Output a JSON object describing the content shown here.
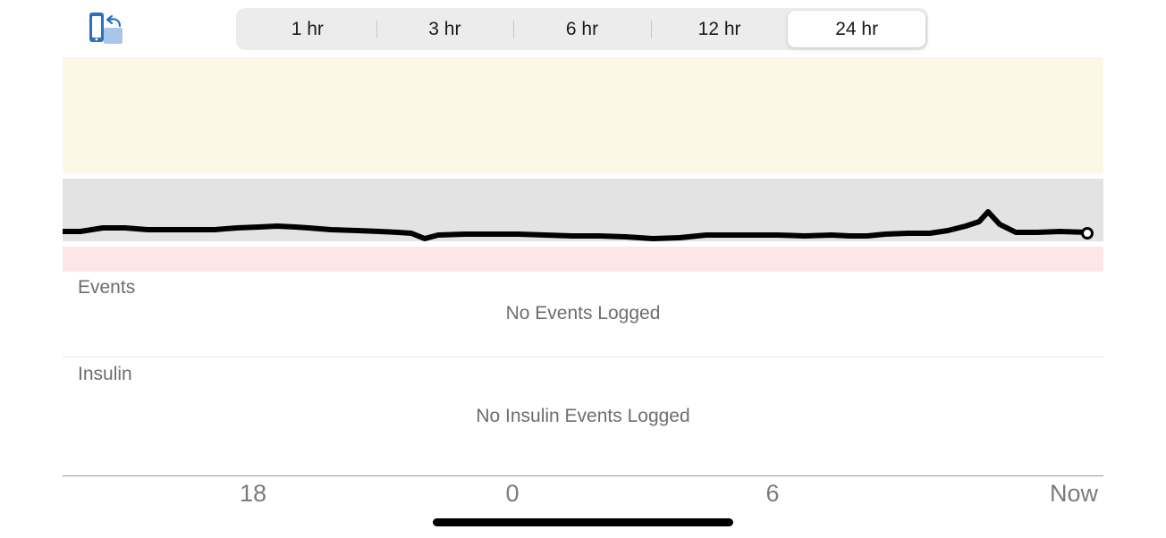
{
  "toolbar": {
    "rotate_icon": "rotate-device-icon",
    "ranges": [
      "1 hr",
      "3 hr",
      "6 hr",
      "12 hr",
      "24 hr"
    ],
    "selected_range": "24 hr"
  },
  "events": {
    "label": "Events",
    "empty_message": "No Events Logged"
  },
  "insulin": {
    "label": "Insulin",
    "empty_message": "No Insulin Events Logged"
  },
  "time_axis": {
    "ticks": [
      "18",
      "0",
      "6",
      "Now"
    ]
  },
  "colors": {
    "high_band": "#fbf8e8",
    "target_band": "#e3e3e4",
    "low_band": "#fde6e8",
    "trace": "#000000",
    "icon_blue": "#2f6fbd"
  }
}
